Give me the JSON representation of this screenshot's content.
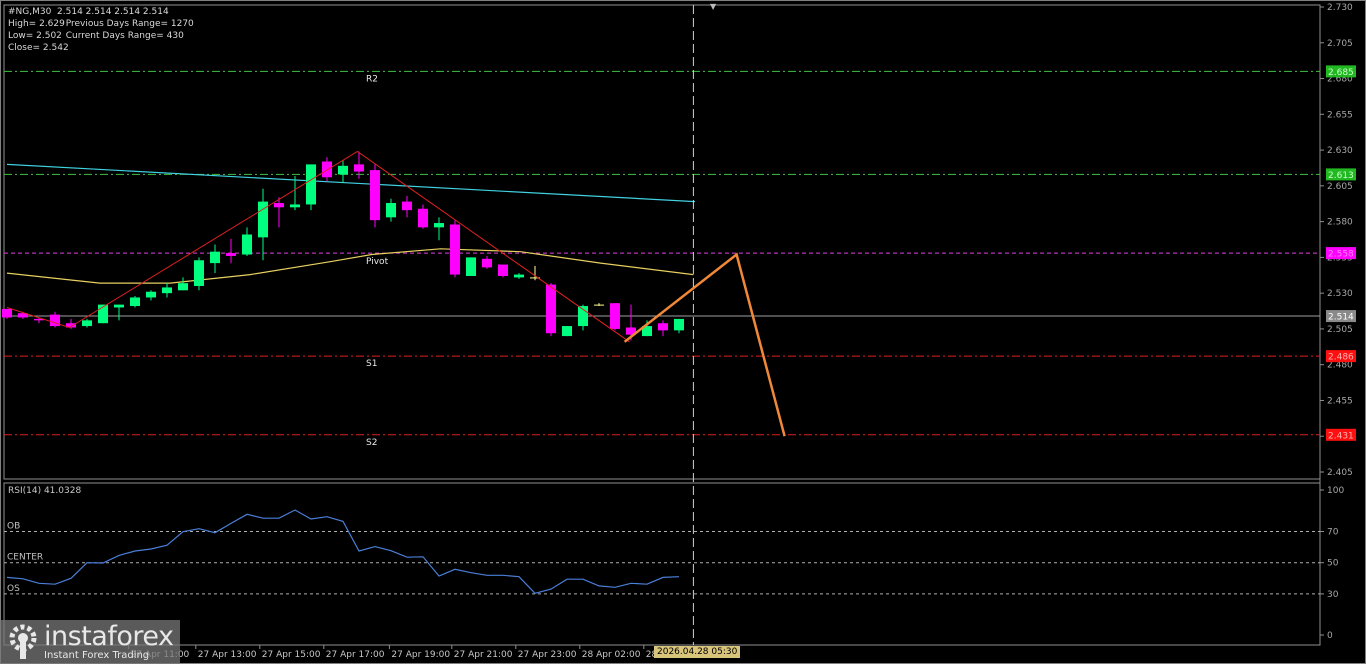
{
  "header": {
    "symbol_line": "#NG,M30  2.514 2.514 2.514 2.514",
    "high": "High= 2.629",
    "low": "Low= 2.502",
    "close": "Close= 2.542",
    "prev_range": "Previous Days Range= 1270",
    "cur_range": "Current Days Range= 430"
  },
  "rsi_title": "RSI(14) 41.0328",
  "crosshair_time": "2026.04.28 05:30",
  "logo": {
    "name": "instaforex",
    "tagline": "Instant Forex Trading"
  },
  "colors": {
    "bull": "#00ff7f",
    "bear": "#ff00ff",
    "cyan_ma": "#40d0e0",
    "yellow_ma": "#e8d060",
    "zigzag": "#e02020",
    "forecast": "#f08838",
    "rsi": "#4a7fd8"
  },
  "chart_data": {
    "type": "candlestick",
    "symbol": "#NG",
    "timeframe": "M30",
    "ylim": [
      2.405,
      2.73
    ],
    "y_ticks": [
      "2.730",
      "2.705",
      "2.680",
      "2.655",
      "2.630",
      "2.605",
      "2.580",
      "2.555",
      "2.530",
      "2.505",
      "2.480",
      "2.455",
      "2.430",
      "2.405"
    ],
    "x_ticks": [
      {
        "index": 7.6,
        "label": "27 Apr 11:00"
      },
      {
        "index": 11.8,
        "label": "27 Apr 13:00"
      },
      {
        "index": 15.8,
        "label": "27 Apr 15:00"
      },
      {
        "index": 19.8,
        "label": "27 Apr 17:00"
      },
      {
        "index": 23.9,
        "label": "27 Apr 19:00"
      },
      {
        "index": 27.8,
        "label": "27 Apr 21:00"
      },
      {
        "index": 31.8,
        "label": "27 Apr 23:00"
      },
      {
        "index": 35.8,
        "label": "28 Apr 02:00"
      },
      {
        "index": 39.8,
        "label": "28"
      }
    ],
    "candles": [
      [
        2.519,
        2.519,
        2.512,
        2.513
      ],
      [
        2.516,
        2.517,
        2.512,
        2.513
      ],
      [
        2.512,
        2.513,
        2.509,
        2.511
      ],
      [
        2.515,
        2.517,
        2.506,
        2.507
      ],
      [
        2.509,
        2.512,
        2.505,
        2.506
      ],
      [
        2.507,
        2.512,
        2.506,
        2.511
      ],
      [
        2.509,
        2.522,
        2.509,
        2.522
      ],
      [
        2.52,
        2.522,
        2.511,
        2.522
      ],
      [
        2.521,
        2.528,
        2.52,
        2.527
      ],
      [
        2.527,
        2.532,
        2.525,
        2.531
      ],
      [
        2.53,
        2.537,
        2.527,
        2.534
      ],
      [
        2.532,
        2.541,
        2.532,
        2.537
      ],
      [
        2.535,
        2.555,
        2.532,
        2.553
      ],
      [
        2.551,
        2.564,
        2.544,
        2.559
      ],
      [
        2.558,
        2.568,
        2.551,
        2.556
      ],
      [
        2.557,
        2.576,
        2.556,
        2.571
      ],
      [
        2.569,
        2.603,
        2.553,
        2.594
      ],
      [
        2.593,
        2.597,
        2.576,
        2.59
      ],
      [
        2.59,
        2.612,
        2.588,
        2.592
      ],
      [
        2.592,
        2.62,
        2.588,
        2.62
      ],
      [
        2.622,
        2.625,
        2.608,
        2.611
      ],
      [
        2.613,
        2.623,
        2.607,
        2.619
      ],
      [
        2.62,
        2.629,
        2.61,
        2.615
      ],
      [
        2.616,
        2.62,
        2.576,
        2.581
      ],
      [
        2.583,
        2.596,
        2.58,
        2.593
      ],
      [
        2.594,
        2.598,
        2.583,
        2.588
      ],
      [
        2.589,
        2.592,
        2.575,
        2.576
      ],
      [
        2.576,
        2.583,
        2.567,
        2.579
      ],
      [
        2.578,
        2.581,
        2.541,
        2.543
      ],
      [
        2.542,
        2.555,
        2.542,
        2.555
      ],
      [
        2.554,
        2.556,
        2.547,
        2.548
      ],
      [
        2.55,
        2.55,
        2.541,
        2.542
      ],
      [
        2.541,
        2.544,
        2.54,
        2.543
      ],
      [
        2.541,
        2.549,
        2.539,
        2.541
      ],
      [
        2.536,
        2.537,
        2.5,
        2.502
      ],
      [
        2.5,
        2.507,
        2.5,
        2.507
      ],
      [
        2.507,
        2.522,
        2.504,
        2.521
      ],
      [
        2.522,
        2.523,
        2.521,
        2.522
      ],
      [
        2.523,
        2.523,
        2.504,
        2.505
      ],
      [
        2.506,
        2.522,
        2.497,
        2.501
      ],
      [
        2.5,
        2.511,
        2.5,
        2.507
      ],
      [
        2.509,
        2.511,
        2.5,
        2.504
      ],
      [
        2.504,
        2.512,
        2.502,
        2.512
      ]
    ],
    "candle_format": "open,high,low,close",
    "levels": [
      {
        "name": "R2",
        "price": 2.685,
        "label": "2.685",
        "text": "R2",
        "color": "#40c040",
        "label_bg": "#22b822",
        "style": "dashdot"
      },
      {
        "name": "R1",
        "price": 2.613,
        "label": "2.613",
        "text": "",
        "color": "#40c040",
        "label_bg": "#22b822",
        "style": "dashdot"
      },
      {
        "name": "Pivot",
        "price": 2.558,
        "label": "2.558",
        "text": "Pivot",
        "color": "#e040e0",
        "label_bg": "#ff00ff",
        "style": "dash"
      },
      {
        "name": "Bid",
        "price": 2.514,
        "label": "2.514",
        "text": "",
        "color": "#a0a0a0",
        "label_bg": "#8a8a8a",
        "style": "solid"
      },
      {
        "name": "S1",
        "price": 2.486,
        "label": "2.486",
        "text": "S1",
        "color": "#e02020",
        "label_bg": "#ff1010",
        "style": "dashdot"
      },
      {
        "name": "S2",
        "price": 2.431,
        "label": "2.431",
        "text": "S2",
        "color": "#e02020",
        "label_bg": "#ff1010",
        "style": "dashdot"
      }
    ],
    "cyan_ma": [
      [
        0,
        2.62
      ],
      [
        43,
        2.594
      ]
    ],
    "yellow_ma": [
      [
        0,
        2.544
      ],
      [
        5.8,
        2.537
      ],
      [
        10.2,
        2.537
      ],
      [
        15.2,
        2.543
      ],
      [
        20.2,
        2.552
      ],
      [
        22.8,
        2.557
      ],
      [
        27.1,
        2.561
      ],
      [
        32.1,
        2.559
      ],
      [
        37.1,
        2.551
      ],
      [
        42.9,
        2.543
      ]
    ],
    "zigzag": [
      [
        0,
        2.52
      ],
      [
        3.9,
        2.506
      ],
      [
        21.9,
        2.629
      ],
      [
        38.9,
        2.496
      ]
    ],
    "forecast": [
      [
        38.6,
        2.496
      ],
      [
        45.6,
        2.557
      ],
      [
        48.6,
        2.43
      ]
    ],
    "crosshair_index": 42.9,
    "rsi": {
      "period": 14,
      "ylim": [
        0,
        100
      ],
      "ticks": [
        "100",
        "70",
        "50",
        "30",
        "0"
      ],
      "levels": [
        {
          "label": "OB",
          "value": 70
        },
        {
          "label": "CENTER",
          "value": 50
        },
        {
          "label": "OS",
          "value": 30
        }
      ],
      "values": [
        40.6,
        39.7,
        36.8,
        36.2,
        40.0,
        50.0,
        49.8,
        54.7,
        57.5,
        58.8,
        61.2,
        69.9,
        71.8,
        69.2,
        75.2,
        81.0,
        78.5,
        78.5,
        83.8,
        78.0,
        79.5,
        76.5,
        57.5,
        60.3,
        57.7,
        53.5,
        53.8,
        41.5,
        45.8,
        43.6,
        41.9,
        41.9,
        41.0,
        30.4,
        33.1,
        39.4,
        39.4,
        35.1,
        34.2,
        36.8,
        36.2,
        40.6,
        41.0
      ]
    }
  }
}
